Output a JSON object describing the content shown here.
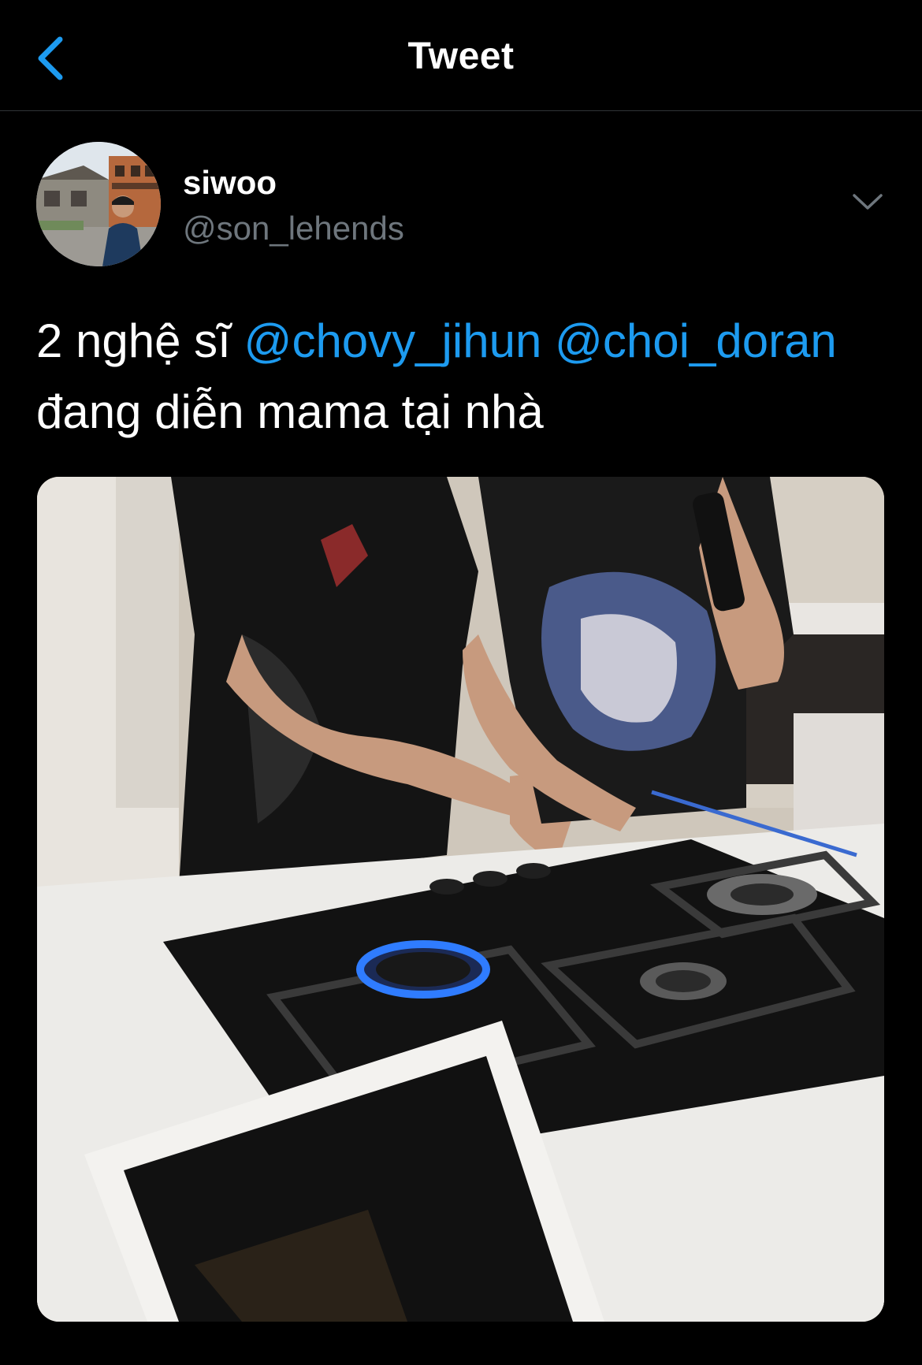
{
  "header": {
    "title": "Tweet",
    "back_icon": "chevron-left-icon"
  },
  "author": {
    "display_name": "siwoo",
    "handle": "@son_lehends",
    "menu_icon": "chevron-down-icon"
  },
  "tweet": {
    "line1_prefix": "2 nghệ sĩ ",
    "mention1": "@chovy_jihun",
    "mention2": "@choi_doran",
    "line2": "đang diễn mama tại nhà"
  },
  "colors": {
    "background": "#000000",
    "accent": "#1d9bf0",
    "secondary_text": "#6e767d",
    "divider": "#2f3336"
  }
}
